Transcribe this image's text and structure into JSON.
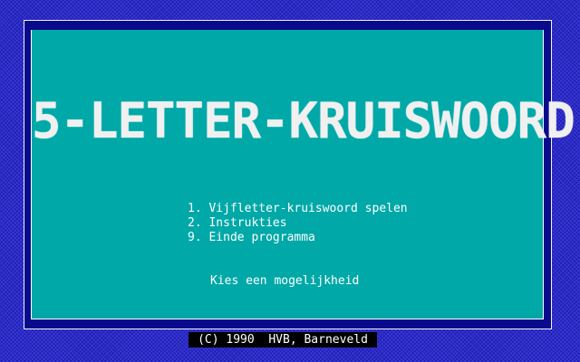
{
  "title": "5-LETTER-KRUISWOORD",
  "menu": {
    "items": [
      {
        "key": "1",
        "label": "1. Vijfletter-kruiswoord spelen"
      },
      {
        "key": "2",
        "label": "2. Instrukties"
      },
      {
        "key": "9",
        "label": "9. Einde programma"
      }
    ],
    "prompt": "Kies een mogelijkheid"
  },
  "footer": {
    "copyright": "(C) 1990  HVB, Barneveld"
  },
  "colors": {
    "background": "#1f1fb0",
    "panel": "#00a8a8",
    "frame": "#0a0a8c",
    "text": "#ffffff"
  }
}
